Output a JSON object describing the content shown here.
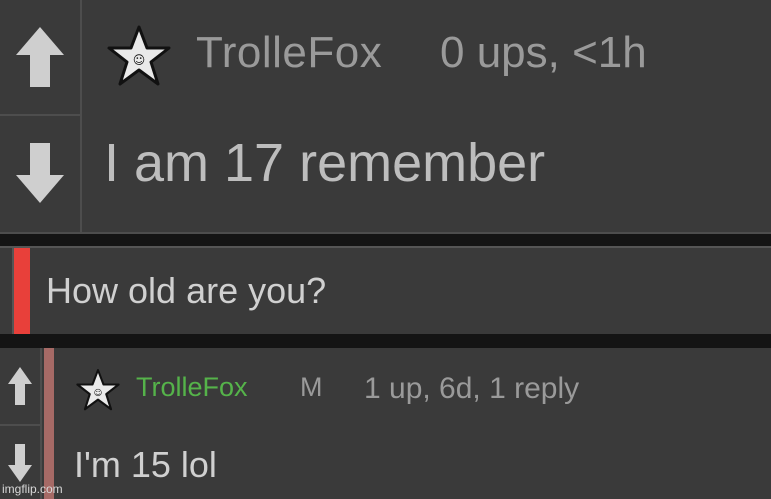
{
  "reply": {
    "username": "TrolleFox",
    "meta": "0 ups, <1h",
    "body": "I am 17 remember"
  },
  "parent": {
    "text": "How old are you?"
  },
  "comment": {
    "username": "TrolleFox",
    "mod_badge": "M",
    "meta": "1 up, 6d, 1 reply",
    "body": "I'm 15 lol"
  },
  "watermark": "imgflip.com",
  "colors": {
    "background": "#3a3a3a",
    "separator": "#141414",
    "quote_bar": "#e8403a",
    "comment_bar": "#a66a66",
    "username_green": "#55b34a",
    "muted_text": "#9a9a9a",
    "arrow": "#cfcfcf"
  },
  "icons": {
    "upvote": "arrow-up-icon",
    "downvote": "arrow-down-icon",
    "user_star": "star-icon"
  }
}
